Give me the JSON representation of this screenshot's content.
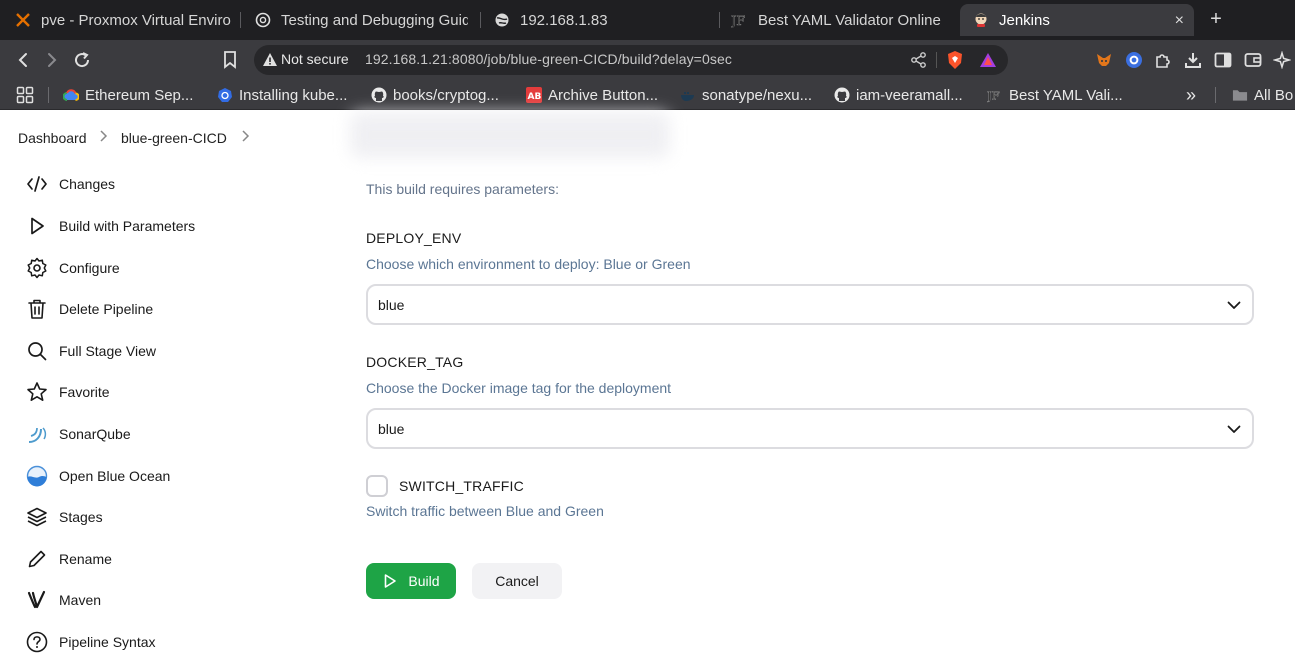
{
  "browser": {
    "tabs": [
      {
        "title": "pve - Proxmox Virtual Enviro",
        "icon": "proxmox-icon"
      },
      {
        "title": "Testing and Debugging Guid",
        "icon": "openai-icon"
      },
      {
        "title": "192.168.1.83",
        "icon": "globe-icon"
      },
      {
        "title": "Best YAML Validator Online",
        "icon": "jf-logo-icon"
      },
      {
        "title": "Jenkins",
        "icon": "jenkins-icon",
        "active": true
      }
    ],
    "close_symbol": "×",
    "new_tab_symbol": "+",
    "address": {
      "security_label": "Not secure",
      "url": "192.168.1.21:8080/job/blue-green-CICD/build?delay=0sec"
    },
    "bookmarks": [
      {
        "label": "Ethereum Sep...",
        "icon": "google-cloud-icon"
      },
      {
        "label": "Installing kube...",
        "icon": "kubernetes-icon"
      },
      {
        "label": "books/cryptog...",
        "icon": "github-icon"
      },
      {
        "label": "Archive Button...",
        "icon": "ab-icon"
      },
      {
        "label": "sonatype/nexu...",
        "icon": "docker-icon"
      },
      {
        "label": "iam-veeramall...",
        "icon": "github-icon"
      },
      {
        "label": "Best YAML Vali...",
        "icon": "jf-logo-icon"
      }
    ],
    "bookmarks_overflow": "»",
    "all_bookmarks_label": "All Bo"
  },
  "breadcrumb": {
    "items": [
      "Dashboard",
      "blue-green-CICD"
    ]
  },
  "sidebar": {
    "items": [
      {
        "label": "Changes",
        "icon": "code-icon"
      },
      {
        "label": "Build with Parameters",
        "icon": "play-icon"
      },
      {
        "label": "Configure",
        "icon": "gear-icon"
      },
      {
        "label": "Delete Pipeline",
        "icon": "trash-icon"
      },
      {
        "label": "Full Stage View",
        "icon": "search-icon"
      },
      {
        "label": "Favorite",
        "icon": "star-icon"
      },
      {
        "label": "SonarQube",
        "icon": "sonarqube-icon"
      },
      {
        "label": "Open Blue Ocean",
        "icon": "blue-ocean-icon"
      },
      {
        "label": "Stages",
        "icon": "layers-icon"
      },
      {
        "label": "Rename",
        "icon": "pencil-icon"
      },
      {
        "label": "Maven",
        "icon": "maven-icon"
      },
      {
        "label": "Pipeline Syntax",
        "icon": "help-icon"
      }
    ]
  },
  "form": {
    "requires_text": "This build requires parameters:",
    "params": [
      {
        "name": "DEPLOY_ENV",
        "description": "Choose which environment to deploy: Blue or Green",
        "value": "blue"
      },
      {
        "name": "DOCKER_TAG",
        "description": "Choose the Docker image tag for the deployment",
        "value": "blue"
      }
    ],
    "switch_traffic": {
      "name": "SWITCH_TRAFFIC",
      "description": "Switch traffic between Blue and Green",
      "checked": false
    },
    "build_label": "Build",
    "cancel_label": "Cancel"
  },
  "colors": {
    "build_button": "#1ea446",
    "description_text": "#5b7694",
    "chrome_dark": "#1f1f22",
    "chrome_toolbar": "#3b3b3f"
  }
}
